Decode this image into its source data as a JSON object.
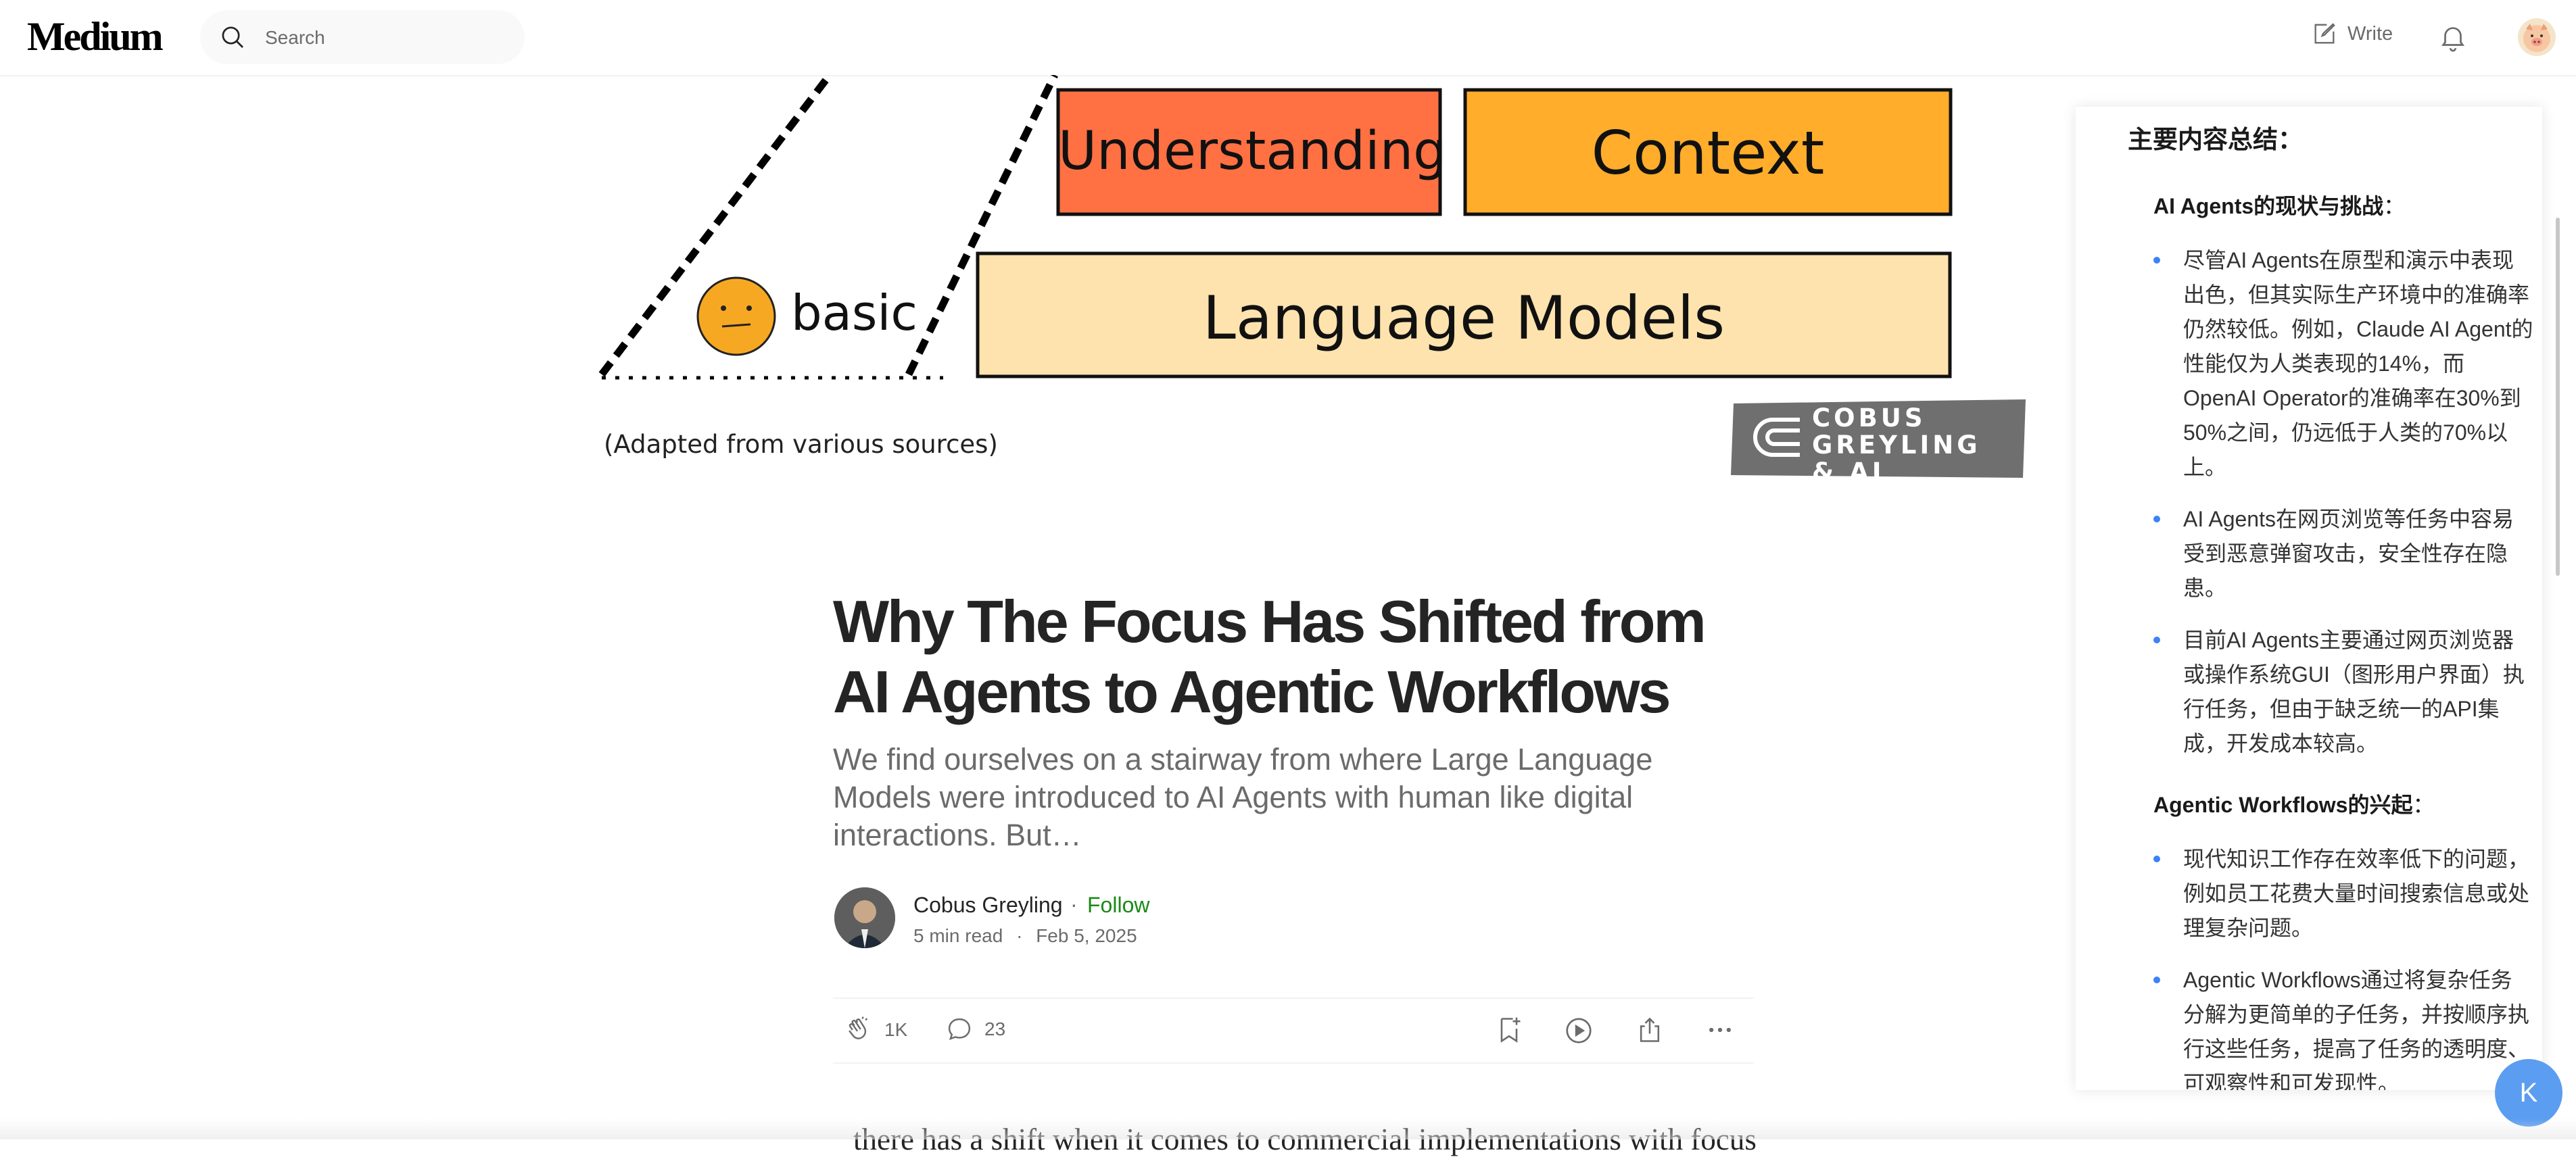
{
  "topbar": {
    "logo": "Medium",
    "search_placeholder": "Search",
    "write_label": "Write"
  },
  "hero": {
    "understanding": "Understanding",
    "context": "Context",
    "language_models": "Language Models",
    "basic": "basic",
    "caption": "(Adapted from various sources)",
    "watermark_line1": "COBUS GREYLING",
    "watermark_line2": "& AI",
    "colors": {
      "understanding": "#ff7043",
      "context": "#ffad2a",
      "language_models": "#ffe3ae",
      "face": "#f7a823"
    }
  },
  "article": {
    "title": "Why The Focus Has Shifted from AI Agents to Agentic Workflows",
    "subtitle": "We find ourselves on a stairway from where Large Language Models were introduced to AI Agents with human like digital interactions. But…",
    "author": "Cobus Greyling",
    "separator": "·",
    "follow_label": "Follow",
    "read_time": "5 min read",
    "date": "Feb 5, 2025",
    "claps": "1K",
    "responses": "23",
    "body_preview": "there has a shift when it comes to commercial implementations with focus"
  },
  "summary": {
    "heading": "主要内容总结：",
    "sections": [
      {
        "title": "AI Agents的现状与挑战",
        "suffix": "：",
        "bullets": [
          "尽管AI Agents在原型和演示中表现出色，但其实际生产环境中的准确率仍然较低。例如，Claude AI Agent的性能仅为人类表现的14%，而OpenAI Operator的准确率在30%到50%之间，仍远低于人类的70%以上。",
          "AI Agents在网页浏览等任务中容易受到恶意弹窗攻击，安全性存在隐患。",
          "目前AI Agents主要通过网页浏览器或操作系统GUI（图形用户界面）执行任务，但由于缺乏统一的API集成，开发成本较高。"
        ]
      },
      {
        "title": "Agentic Workflows的兴起",
        "suffix": "：",
        "bullets": [
          "现代知识工作存在效率低下的问题，例如员工花费大量时间搜索信息或处理复杂问题。",
          "Agentic Workflows通过将复杂任务分解为更简单的子任务，并按顺序执行这些任务，提高了任务的透明度、可观察性和可发现性。"
        ]
      }
    ],
    "fab_label": "K",
    "accent": "#3b82f6"
  },
  "colors": {
    "follow": "#1a8917",
    "fab": "#5b9df0"
  }
}
